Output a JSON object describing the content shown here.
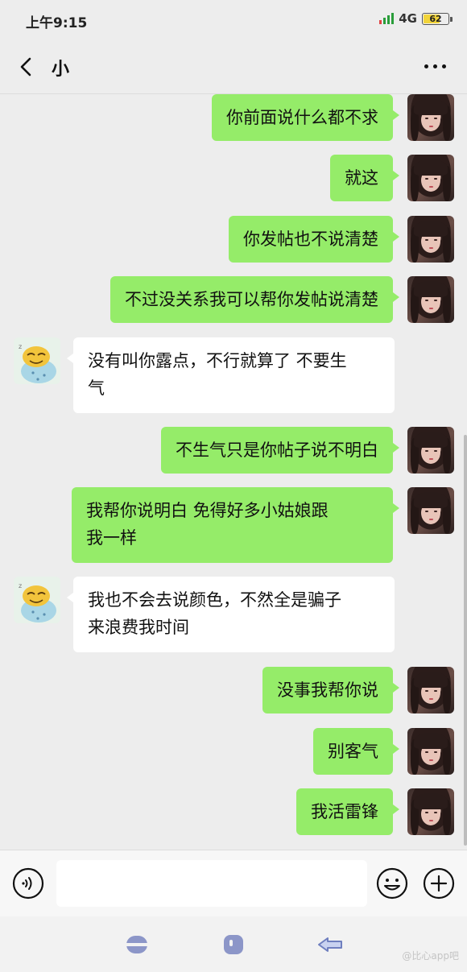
{
  "status_bar": {
    "time": "上午9:15",
    "network": "4G",
    "battery": "62"
  },
  "header": {
    "title": "小"
  },
  "messages": [
    {
      "from": "me",
      "text": "你前面说什么都不求"
    },
    {
      "from": "me",
      "text": "就这"
    },
    {
      "from": "me",
      "text": "你发帖也不说清楚"
    },
    {
      "from": "me",
      "text": "不过没关系我可以帮你发帖说清楚"
    },
    {
      "from": "them",
      "line1": "没有叫你露点，不行就算了 不要生",
      "line2": "气"
    },
    {
      "from": "me",
      "text": "不生气只是你帖子说不明白"
    },
    {
      "from": "me",
      "line1": "我帮你说明白 免得好多小姑娘跟",
      "line2": "我一样"
    },
    {
      "from": "them",
      "line1": "我也不会去说颜色，不然全是骗子",
      "line2": "来浪费我时间"
    },
    {
      "from": "me",
      "text": "没事我帮你说"
    },
    {
      "from": "me",
      "text": "别客气"
    },
    {
      "from": "me",
      "text": "我活雷锋"
    }
  ],
  "input": {
    "value": ""
  },
  "watermark": "@比心app吧",
  "icons": {
    "back": "chevron-left-icon",
    "more": "more-dots-icon",
    "voice": "voice-icon",
    "emoji": "emoji-icon",
    "plus": "plus-icon",
    "nav_menu": "menu-icon",
    "nav_home": "home-icon",
    "nav_back": "back-arrow-icon"
  },
  "colors": {
    "bubble_me": "#95ec69",
    "bubble_them": "#ffffff",
    "background": "#ededed"
  }
}
